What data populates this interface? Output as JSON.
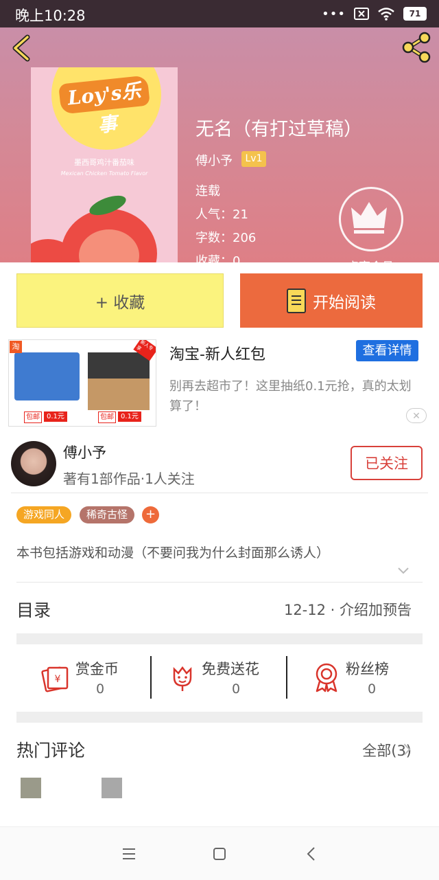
{
  "status_bar": {
    "time": "晚上10:28",
    "battery": "71"
  },
  "book": {
    "title": "无名（有打过草稿）",
    "author": "傅小予",
    "level": "Lv1",
    "status": "连载",
    "popularity": "人气：21",
    "word_count": "字数：206",
    "favorites": "收藏：0",
    "vip_label": "点亮会员",
    "cover_logo": "Loy's乐事",
    "cover_line1": "墨西哥鸡汁番茄味",
    "cover_line2": "Mexican Chicken Tomato Flavor"
  },
  "actions": {
    "collect": "+ 收藏",
    "read": "开始阅读"
  },
  "ad": {
    "title": "淘宝-新人红包",
    "detail_button": "查看详情",
    "description": "别再去超市了！这里抽纸0.1元抢，真的太划算了！",
    "tag": "淘",
    "free_ship": "包邮",
    "price": "0.1元",
    "new_user": "新人专享"
  },
  "author_card": {
    "name": "傅小予",
    "info": "著有1部作品·1人关注",
    "follow_button": "已关注"
  },
  "tags": [
    {
      "label": "游戏同人",
      "color": "#f5a623"
    },
    {
      "label": "稀奇古怪",
      "color": "#b5746a"
    }
  ],
  "tag_add": "+",
  "description": "本书包括游戏和动漫（不要问我为什么封面那么诱人）",
  "toc": {
    "title": "目录",
    "latest": "12-12 · 介绍加预告"
  },
  "stats": [
    {
      "label": "赏金币",
      "value": "0",
      "icon": "red-envelope-icon"
    },
    {
      "label": "免费送花",
      "value": "0",
      "icon": "flower-icon"
    },
    {
      "label": "粉丝榜",
      "value": "0",
      "icon": "medal-icon"
    }
  ],
  "hot_comments": {
    "title": "热门评论",
    "all": "全部(3)"
  },
  "colors": {
    "accent_orange": "#ec6a3e",
    "collect_yellow": "#fbf37e",
    "follow_red": "#d8403a",
    "ad_blue": "#1f6fe0"
  }
}
